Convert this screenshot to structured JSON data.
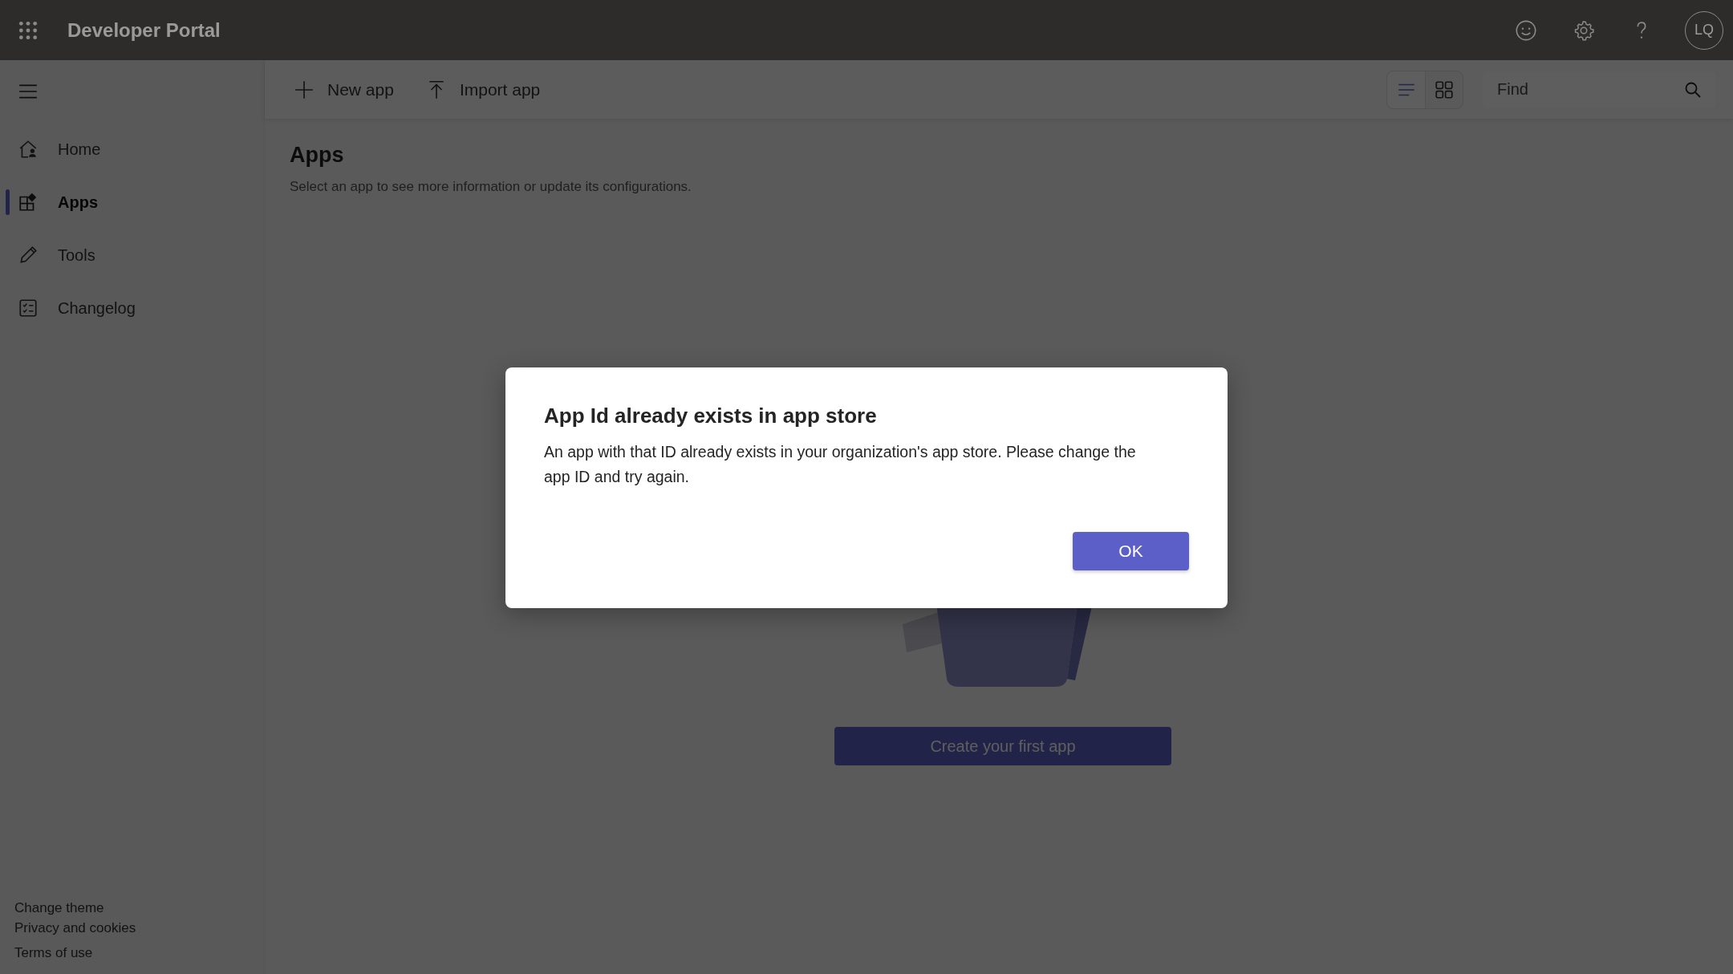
{
  "header": {
    "title": "Developer Portal",
    "avatar": "LQ"
  },
  "sidebar": {
    "items": [
      {
        "label": "Home",
        "selected": false
      },
      {
        "label": "Apps",
        "selected": true
      },
      {
        "label": "Tools",
        "selected": false
      },
      {
        "label": "Changelog",
        "selected": false
      }
    ],
    "footer_links": [
      "Change theme",
      "Privacy and cookies",
      "Terms of use"
    ]
  },
  "toolbar": {
    "actions": [
      {
        "label": "New app"
      },
      {
        "label": "Import app"
      }
    ],
    "views": [
      {
        "selected": true
      },
      {
        "selected": false
      }
    ],
    "search": {
      "placeholder": "Find"
    }
  },
  "page": {
    "title": "Apps",
    "subtitle": "Select an app to see more information or update its configurations.",
    "create_button": "Create your first app"
  },
  "dialog": {
    "title": "App Id already exists in app store",
    "message": "An app with that ID already exists in your organization's app store. Please change the app ID and try again.",
    "button": "OK"
  }
}
